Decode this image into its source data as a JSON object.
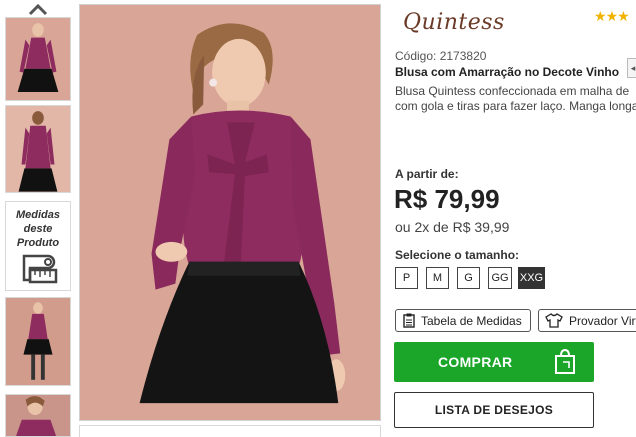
{
  "brand": {
    "logo_text": "Quintess"
  },
  "rating": {
    "stars_filled": 3,
    "stars_total": 3,
    "star_color": "#f0b400"
  },
  "product": {
    "code_label": "Código: 2173820",
    "name": "Blusa com Amarração no Decote Vinho",
    "description_line1": "Blusa Quintess confeccionada em malha de",
    "description_line2": "com gola e tiras para fazer laço. Manga longa"
  },
  "price": {
    "from_label": "A partir de:",
    "main": "R$ 79,99",
    "installment": "ou 2x de R$ 39,99"
  },
  "sizes": {
    "label": "Selecione o tamanho:",
    "options": [
      "P",
      "M",
      "G",
      "GG",
      "XXG"
    ],
    "selected": "XXG"
  },
  "thumbnails": {
    "measure_card_text": "Medidas deste Produto"
  },
  "actions": {
    "measures_table": "Tabela de Medidas",
    "virtual_fitting": "Provador Virtual",
    "buy": "COMPRAR",
    "wishlist": "LISTA DE DESEJOS"
  },
  "colors": {
    "buy_green": "#1ba62a",
    "blouse_wine": "#8e2c60",
    "brand_brown": "#6b3a26",
    "photo_background": "#d9a596"
  }
}
